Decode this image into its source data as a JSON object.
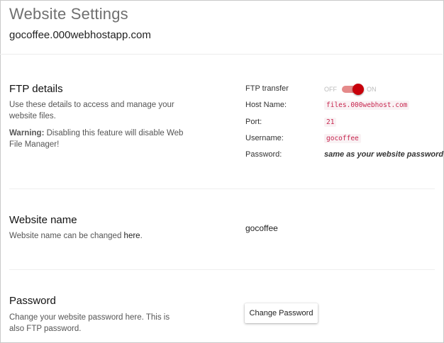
{
  "header": {
    "title": "Website Settings",
    "domain": "gocoffee.000webhostapp.com"
  },
  "ftp": {
    "title": "FTP details",
    "description": "Use these details to access and manage your website files.",
    "warning_label": "Warning:",
    "warning_text": " Disabling this feature will disable Web File Manager!",
    "transfer_label": "FTP transfer",
    "toggle_off": "OFF",
    "toggle_on": "ON",
    "toggle_state": true,
    "toggle_color": "#c8000b",
    "host_label": "Host Name:",
    "host_value": "files.000webhost.com",
    "port_label": "Port:",
    "port_value": "21",
    "username_label": "Username:",
    "username_value": "gocoffee",
    "password_label": "Password:",
    "password_value": "same as your website password"
  },
  "website_name": {
    "title": "Website name",
    "desc_prefix": "Website name can be changed ",
    "desc_link": "here",
    "desc_suffix": ".",
    "value": "gocoffee"
  },
  "password": {
    "title": "Password",
    "description": "Change your website password here. This is also FTP password.",
    "button_label": "Change Password"
  }
}
